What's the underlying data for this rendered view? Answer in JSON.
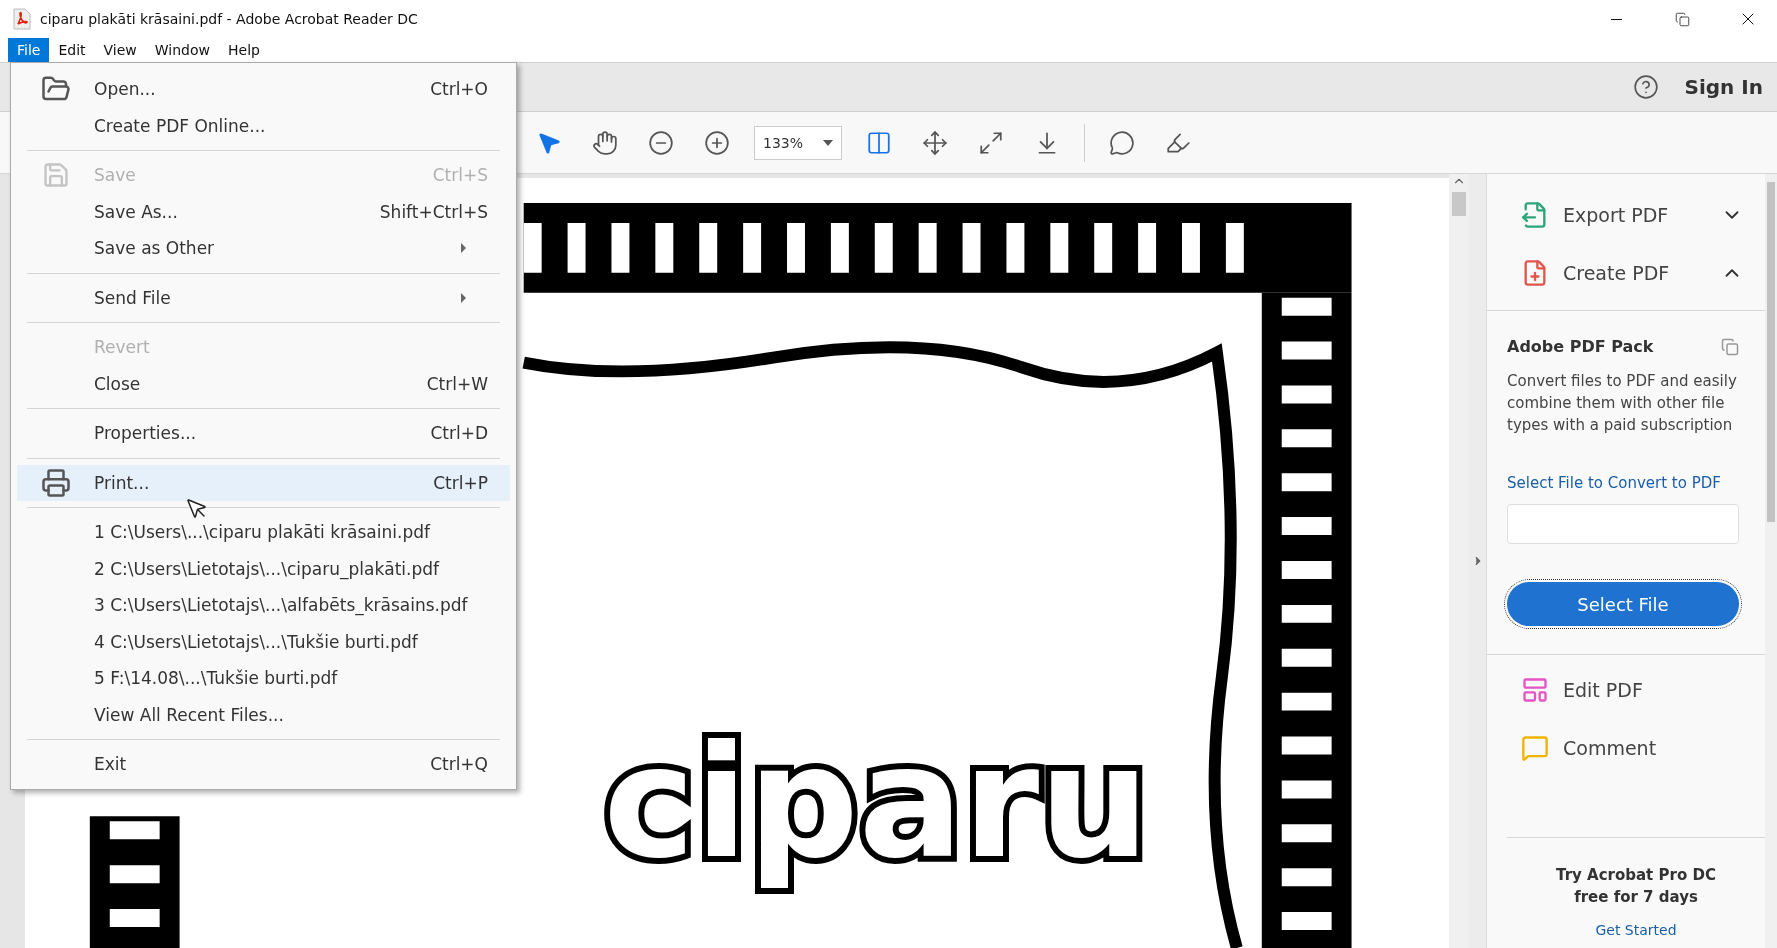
{
  "window": {
    "title": "ciparu plakāti krāsaini.pdf - Adobe Acrobat Reader DC"
  },
  "menu_bar": [
    {
      "label": "File",
      "selected": true
    },
    {
      "label": "Edit",
      "selected": false
    },
    {
      "label": "View",
      "selected": false
    },
    {
      "label": "Window",
      "selected": false
    },
    {
      "label": "Help",
      "selected": false
    }
  ],
  "file_menu": [
    {
      "kind": "item",
      "label": "Open...",
      "shortcut": "Ctrl+O",
      "disabled": false,
      "selected": false
    },
    {
      "kind": "item",
      "label": "Create PDF Online...",
      "disabled": false,
      "selected": false
    },
    {
      "kind": "separator"
    },
    {
      "kind": "item",
      "label": "Save",
      "shortcut": "Ctrl+S",
      "disabled": true,
      "selected": false
    },
    {
      "kind": "item",
      "label": "Save As...",
      "shortcut": "Shift+Ctrl+S",
      "disabled": false,
      "selected": false
    },
    {
      "kind": "submenu",
      "label": "Save as Other",
      "disabled": false,
      "selected": false
    },
    {
      "kind": "separator"
    },
    {
      "kind": "submenu",
      "label": "Send File",
      "disabled": false,
      "selected": false
    },
    {
      "kind": "separator"
    },
    {
      "kind": "item",
      "label": "Revert",
      "disabled": true,
      "selected": false
    },
    {
      "kind": "item",
      "label": "Close",
      "shortcut": "Ctrl+W",
      "disabled": false,
      "selected": false
    },
    {
      "kind": "separator"
    },
    {
      "kind": "item",
      "label": "Properties...",
      "shortcut": "Ctrl+D",
      "disabled": false,
      "selected": false
    },
    {
      "kind": "separator"
    },
    {
      "kind": "item",
      "label": "Print...",
      "shortcut": "Ctrl+P",
      "disabled": false,
      "selected": true
    },
    {
      "kind": "separator"
    },
    {
      "kind": "item",
      "label": "1 C:\\Users\\...\\ciparu plakāti krāsaini.pdf",
      "disabled": false,
      "selected": false
    },
    {
      "kind": "item",
      "label": "2 C:\\Users\\Lietotajs\\...\\ciparu_plakāti.pdf",
      "disabled": false,
      "selected": false
    },
    {
      "kind": "item",
      "label": "3 C:\\Users\\Lietotajs\\...\\alfabēts_krāsains.pdf",
      "disabled": false,
      "selected": false
    },
    {
      "kind": "item",
      "label": "4 C:\\Users\\Lietotajs\\...\\Tukšie burti.pdf",
      "disabled": false,
      "selected": false
    },
    {
      "kind": "item",
      "label": "5 F:\\14.08\\...\\Tukšie burti.pdf",
      "disabled": false,
      "selected": false
    },
    {
      "kind": "item",
      "label": "View All Recent Files...",
      "disabled": false,
      "selected": false
    },
    {
      "kind": "separator"
    },
    {
      "kind": "item",
      "label": "Exit",
      "shortcut": "Ctrl+Q",
      "disabled": false,
      "selected": false
    }
  ],
  "header": {
    "sign_in": "Sign In"
  },
  "toolbar": {
    "tools": [
      {
        "kind": "select",
        "selected": true
      },
      {
        "kind": "hand",
        "selected": false
      },
      {
        "kind": "zoom-out",
        "selected": false
      },
      {
        "kind": "zoom-in",
        "selected": false
      },
      {
        "kind": "zoom",
        "value": "133%"
      },
      {
        "kind": "fit-width",
        "selected": true
      },
      {
        "kind": "move-page",
        "selected": false
      },
      {
        "kind": "full-screen",
        "selected": false
      },
      {
        "kind": "scroll-mode",
        "selected": false
      },
      {
        "kind": "divider"
      },
      {
        "kind": "comment",
        "selected": false
      },
      {
        "kind": "highlight",
        "selected": false
      }
    ]
  },
  "document": {
    "poster_text": "ciparu"
  },
  "right_panel": {
    "tools": [
      {
        "kind": "export",
        "label": "Export PDF",
        "expanded": false
      },
      {
        "kind": "create",
        "label": "Create PDF",
        "expanded": true
      }
    ],
    "pack": {
      "title": "Adobe PDF Pack",
      "description": "Convert files to PDF and easily combine them with other file types with a paid subscription",
      "link": "Select File to Convert to PDF",
      "button": "Select File"
    },
    "more_tools": [
      {
        "kind": "edit",
        "label": "Edit PDF"
      },
      {
        "kind": "comment",
        "label": "Comment"
      }
    ],
    "promo": {
      "title_line_1": "Try Acrobat Pro DC",
      "title_line_2": "free for 7 days",
      "link": "Get Started"
    }
  }
}
